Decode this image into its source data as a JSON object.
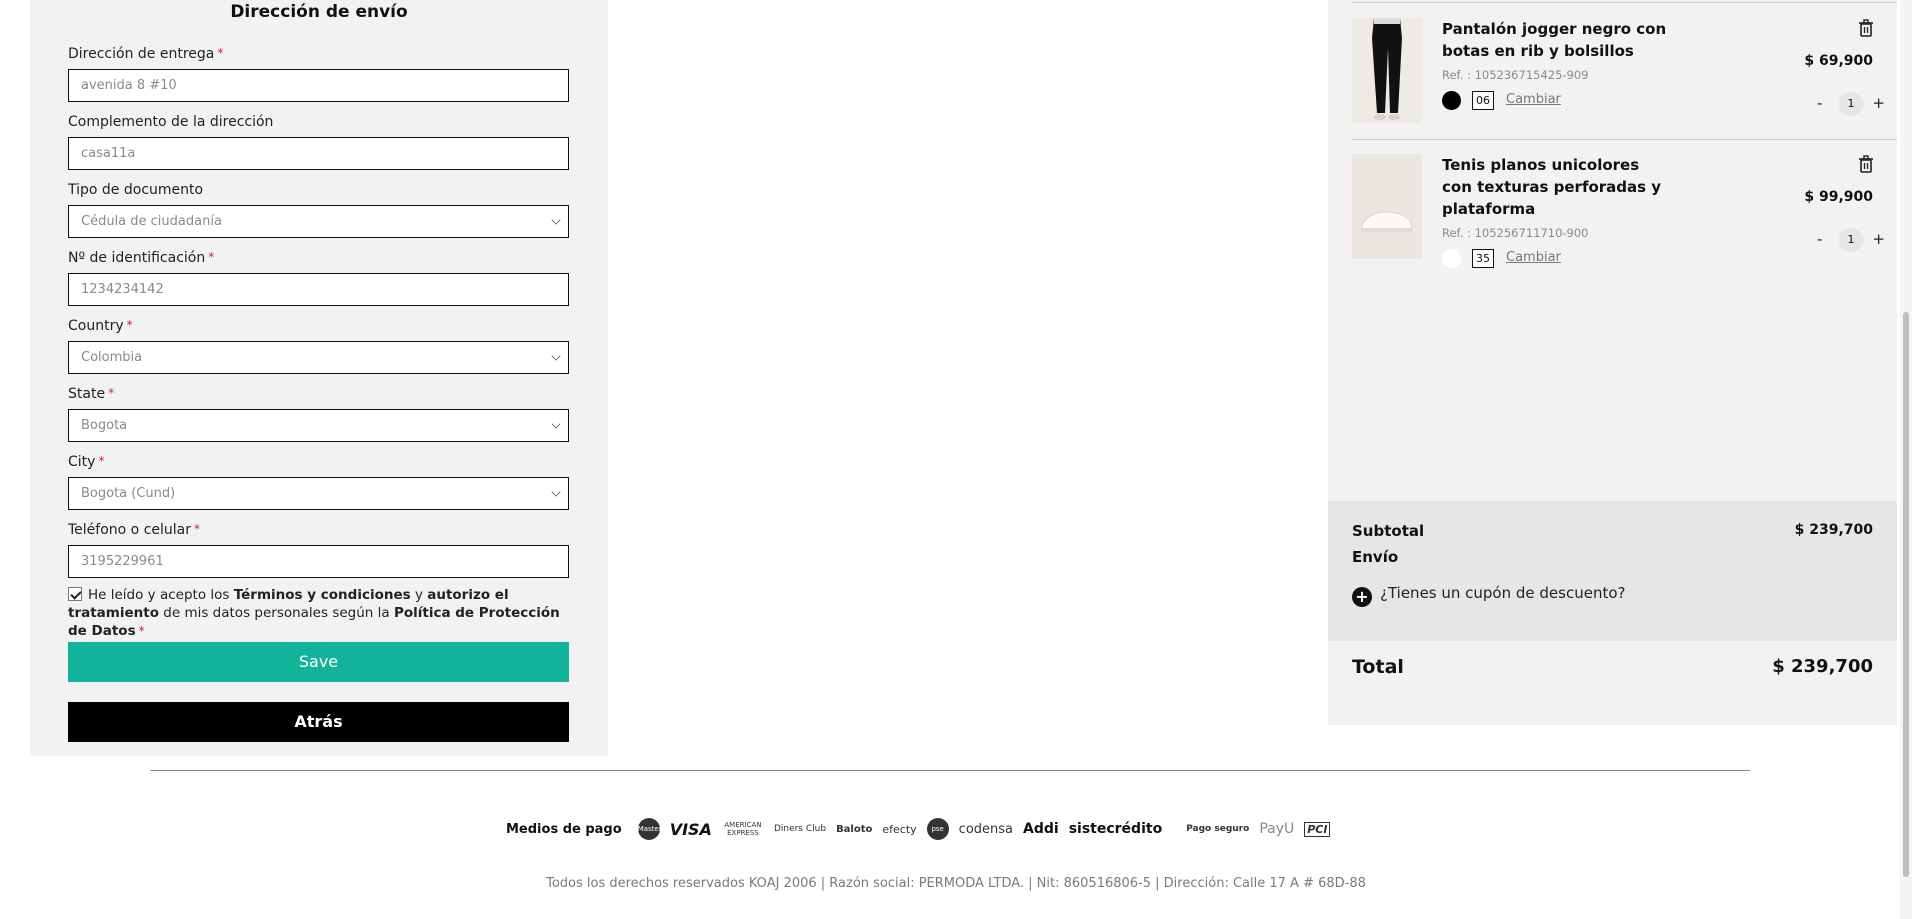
{
  "form": {
    "title": "Dirección de envío",
    "required_mark": "*",
    "fields": [
      {
        "label": "Dirección de entrega",
        "required": true,
        "value": "avenida 8 #10",
        "type": "text"
      },
      {
        "label": "Complemento de la dirección",
        "required": false,
        "value": "casa11a",
        "type": "text"
      },
      {
        "label": "Tipo de documento",
        "required": false,
        "value": "Cédula de ciudadanía",
        "type": "select"
      },
      {
        "label": "Nº de identificación",
        "required": true,
        "value": "1234234142",
        "type": "text"
      },
      {
        "label": "Country",
        "required": true,
        "value": "Colombia",
        "type": "select"
      },
      {
        "label": "State",
        "required": true,
        "value": "Bogota",
        "type": "select"
      },
      {
        "label": "City",
        "required": true,
        "value": "Bogota (Cund)",
        "type": "select"
      },
      {
        "label": "Teléfono o celular",
        "required": true,
        "value": "3195229961",
        "type": "text"
      }
    ],
    "terms": {
      "checked": true,
      "part1": "He leído y acepto los ",
      "terms_link": "Términos y condiciones",
      "part2": " y ",
      "authorize": "autorizo el tratamiento",
      "part3": " de mis datos personales según la ",
      "policy_link": "Política de Protección de Datos"
    },
    "save_label": "Save",
    "back_label": "Atrás"
  },
  "cart": {
    "items": [
      {
        "name": "Pantalón jogger negro con botas en rib y bolsillos",
        "ref": "Ref. : 105236715425-909",
        "price": "$ 69,900",
        "color": "#000000",
        "size": "06",
        "change_label": "Cambiar",
        "qty": "1",
        "minus": "-",
        "plus": "+"
      },
      {
        "name": "Tenis planos unicolores con texturas perforadas y plataforma",
        "ref": "Ref. : 105256711710-900",
        "price": "$ 99,900",
        "color": "#ffffff",
        "size": "35",
        "change_label": "Cambiar",
        "qty": "1",
        "minus": "-",
        "plus": "+"
      }
    ],
    "subtotal_label": "Subtotal",
    "subtotal": "$ 239,700",
    "shipping_label": "Envío",
    "coupon_label": "¿Tienes un cupón de descuento?",
    "total_label": "Total",
    "total": "$ 239,700"
  },
  "footer": {
    "payments_title": "Medios de pago",
    "payment_logos": [
      "MasterCard",
      "VISA",
      "AMERICAN EXPRESS",
      "Diners Club",
      "Baloto",
      "efecty",
      "pse",
      "codensa",
      "Addi",
      "sistecrédito"
    ],
    "secure_title": "Pago seguro",
    "secure_logos": [
      "PayU",
      "PCI"
    ],
    "copyright": "Todos los derechos reservados KOAJ 2006 | Razón social: PERMODA LTDA. | Nit: 860516806-5 | Dirección: Calle 17 A # 68D-88"
  }
}
